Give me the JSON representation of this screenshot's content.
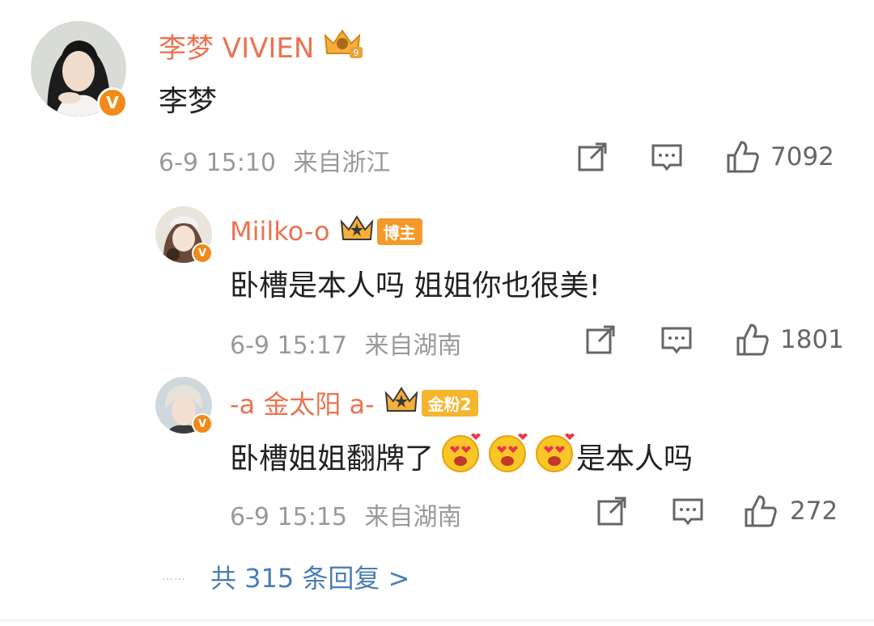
{
  "comments": [
    {
      "user": "李梦 VIVIEN",
      "text": "李梦",
      "time": "6-9 15:10",
      "location": "来自浙江",
      "likes": "7092",
      "level_badge": "9"
    },
    {
      "user": "Miilko-o",
      "text": "卧槽是本人吗 姐姐你也很美!",
      "time": "6-9 15:17",
      "location": "来自湖南",
      "likes": "1801",
      "tag": "博主"
    },
    {
      "user": "-a 金太阳 a-",
      "text_before": "卧槽姐姐翻牌了",
      "text_after": "是本人吗",
      "time": "6-9 15:15",
      "location": "来自湖南",
      "likes": "272",
      "tag": "金粉2"
    }
  ],
  "more_replies": {
    "dots": "……",
    "label": "共 315 条回复 >"
  },
  "icons": {
    "share": "share-icon",
    "comment": "comment-icon",
    "like": "thumbs-up-icon",
    "verified": "verified-v-icon",
    "crown": "crown-icon",
    "emoji": "heart-eyes-emoji-icon"
  },
  "colors": {
    "username": "#eb7350",
    "link": "#4a7db5",
    "meta": "#999999",
    "verified": "#f18a1a"
  }
}
